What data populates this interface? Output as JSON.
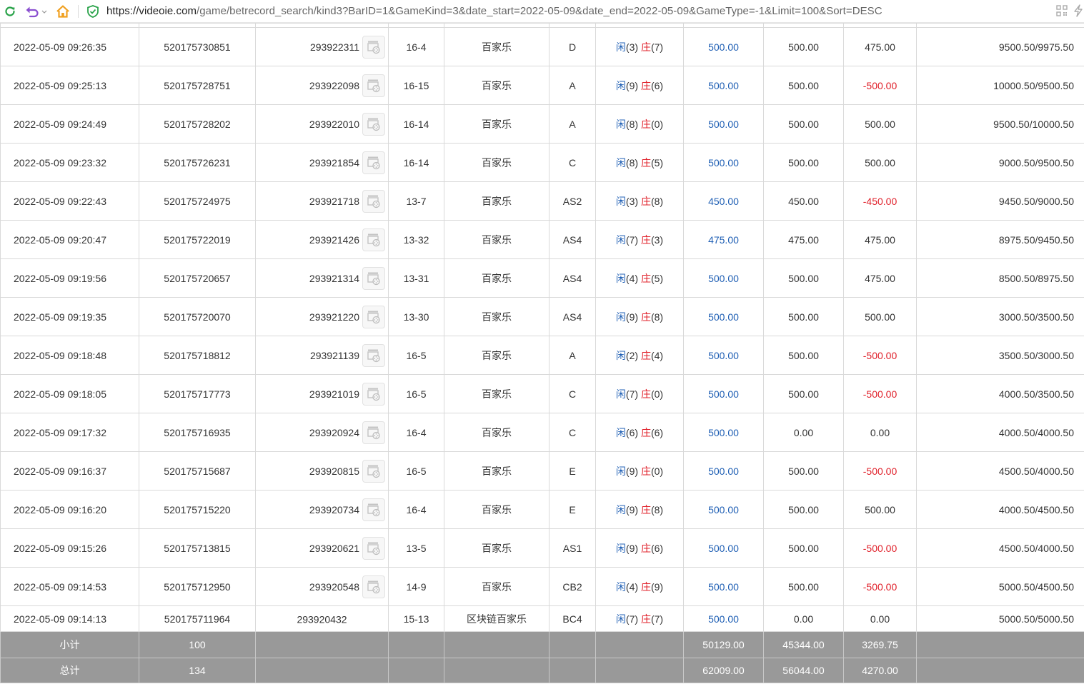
{
  "browser": {
    "url_host": "https://videoie.com",
    "url_path": "/game/betrecord_search/kind3?BarID=1&GameKind=3&date_start=2022-05-09&date_end=2022-05-09&GameType=-1&Limit=100&Sort=DESC"
  },
  "colors": {
    "positive": "#1f5fb4",
    "negative": "#e0202a",
    "summary_bg": "#999999"
  },
  "rows": [
    {
      "time": "2022-05-09 09:26:35",
      "bet_id": "520175730851",
      "game_no": "293922311",
      "shoe": "16-4",
      "game": "百家乐",
      "table": "D",
      "player_label": "闲",
      "player_pts": "(3)",
      "banker_label": "庄",
      "banker_pts": "(7)",
      "bet": "500.00",
      "valid": "500.00",
      "result": "475.00",
      "result_sign": "pos",
      "balance": "9500.50/9975.50",
      "video_icon": "video-replay-icon"
    },
    {
      "time": "2022-05-09 09:25:13",
      "bet_id": "520175728751",
      "game_no": "293922098",
      "shoe": "16-15",
      "game": "百家乐",
      "table": "A",
      "player_label": "闲",
      "player_pts": "(9)",
      "banker_label": "庄",
      "banker_pts": "(6)",
      "bet": "500.00",
      "valid": "500.00",
      "result": "-500.00",
      "result_sign": "neg",
      "balance": "10000.50/9500.50",
      "video_icon": "video-replay-icon"
    },
    {
      "time": "2022-05-09 09:24:49",
      "bet_id": "520175728202",
      "game_no": "293922010",
      "shoe": "16-14",
      "game": "百家乐",
      "table": "A",
      "player_label": "闲",
      "player_pts": "(8)",
      "banker_label": "庄",
      "banker_pts": "(0)",
      "bet": "500.00",
      "valid": "500.00",
      "result": "500.00",
      "result_sign": "pos",
      "balance": "9500.50/10000.50",
      "video_icon": "video-replay-icon"
    },
    {
      "time": "2022-05-09 09:23:32",
      "bet_id": "520175726231",
      "game_no": "293921854",
      "shoe": "16-14",
      "game": "百家乐",
      "table": "C",
      "player_label": "闲",
      "player_pts": "(8)",
      "banker_label": "庄",
      "banker_pts": "(5)",
      "bet": "500.00",
      "valid": "500.00",
      "result": "500.00",
      "result_sign": "pos",
      "balance": "9000.50/9500.50",
      "video_icon": "video-replay-icon"
    },
    {
      "time": "2022-05-09 09:22:43",
      "bet_id": "520175724975",
      "game_no": "293921718",
      "shoe": "13-7",
      "game": "百家乐",
      "table": "AS2",
      "player_label": "闲",
      "player_pts": "(3)",
      "banker_label": "庄",
      "banker_pts": "(8)",
      "bet": "450.00",
      "valid": "450.00",
      "result": "-450.00",
      "result_sign": "neg",
      "balance": "9450.50/9000.50",
      "video_icon": "video-replay-icon"
    },
    {
      "time": "2022-05-09 09:20:47",
      "bet_id": "520175722019",
      "game_no": "293921426",
      "shoe": "13-32",
      "game": "百家乐",
      "table": "AS4",
      "player_label": "闲",
      "player_pts": "(7)",
      "banker_label": "庄",
      "banker_pts": "(3)",
      "bet": "475.00",
      "valid": "475.00",
      "result": "475.00",
      "result_sign": "pos",
      "balance": "8975.50/9450.50",
      "video_icon": "video-replay-icon"
    },
    {
      "time": "2022-05-09 09:19:56",
      "bet_id": "520175720657",
      "game_no": "293921314",
      "shoe": "13-31",
      "game": "百家乐",
      "table": "AS4",
      "player_label": "闲",
      "player_pts": "(4)",
      "banker_label": "庄",
      "banker_pts": "(5)",
      "bet": "500.00",
      "valid": "500.00",
      "result": "475.00",
      "result_sign": "pos",
      "balance": "8500.50/8975.50",
      "video_icon": "video-replay-icon"
    },
    {
      "time": "2022-05-09 09:19:35",
      "bet_id": "520175720070",
      "game_no": "293921220",
      "shoe": "13-30",
      "game": "百家乐",
      "table": "AS4",
      "player_label": "闲",
      "player_pts": "(9)",
      "banker_label": "庄",
      "banker_pts": "(8)",
      "bet": "500.00",
      "valid": "500.00",
      "result": "500.00",
      "result_sign": "pos",
      "balance": "3000.50/3500.50",
      "video_icon": "video-replay-icon"
    },
    {
      "time": "2022-05-09 09:18:48",
      "bet_id": "520175718812",
      "game_no": "293921139",
      "shoe": "16-5",
      "game": "百家乐",
      "table": "A",
      "player_label": "闲",
      "player_pts": "(2)",
      "banker_label": "庄",
      "banker_pts": "(4)",
      "bet": "500.00",
      "valid": "500.00",
      "result": "-500.00",
      "result_sign": "neg",
      "balance": "3500.50/3000.50",
      "video_icon": "video-replay-icon"
    },
    {
      "time": "2022-05-09 09:18:05",
      "bet_id": "520175717773",
      "game_no": "293921019",
      "shoe": "16-5",
      "game": "百家乐",
      "table": "C",
      "player_label": "闲",
      "player_pts": "(7)",
      "banker_label": "庄",
      "banker_pts": "(0)",
      "bet": "500.00",
      "valid": "500.00",
      "result": "-500.00",
      "result_sign": "neg",
      "balance": "4000.50/3500.50",
      "video_icon": "video-replay-icon"
    },
    {
      "time": "2022-05-09 09:17:32",
      "bet_id": "520175716935",
      "game_no": "293920924",
      "shoe": "16-4",
      "game": "百家乐",
      "table": "C",
      "player_label": "闲",
      "player_pts": "(6)",
      "banker_label": "庄",
      "banker_pts": "(6)",
      "bet": "500.00",
      "valid": "0.00",
      "result": "0.00",
      "result_sign": "zero",
      "balance": "4000.50/4000.50",
      "video_icon": "video-replay-icon"
    },
    {
      "time": "2022-05-09 09:16:37",
      "bet_id": "520175715687",
      "game_no": "293920815",
      "shoe": "16-5",
      "game": "百家乐",
      "table": "E",
      "player_label": "闲",
      "player_pts": "(9)",
      "banker_label": "庄",
      "banker_pts": "(0)",
      "bet": "500.00",
      "valid": "500.00",
      "result": "-500.00",
      "result_sign": "neg",
      "balance": "4500.50/4000.50",
      "video_icon": "video-replay-icon"
    },
    {
      "time": "2022-05-09 09:16:20",
      "bet_id": "520175715220",
      "game_no": "293920734",
      "shoe": "16-4",
      "game": "百家乐",
      "table": "E",
      "player_label": "闲",
      "player_pts": "(9)",
      "banker_label": "庄",
      "banker_pts": "(8)",
      "bet": "500.00",
      "valid": "500.00",
      "result": "500.00",
      "result_sign": "pos",
      "balance": "4000.50/4500.50",
      "video_icon": "video-replay-icon"
    },
    {
      "time": "2022-05-09 09:15:26",
      "bet_id": "520175713815",
      "game_no": "293920621",
      "shoe": "13-5",
      "game": "百家乐",
      "table": "AS1",
      "player_label": "闲",
      "player_pts": "(9)",
      "banker_label": "庄",
      "banker_pts": "(6)",
      "bet": "500.00",
      "valid": "500.00",
      "result": "-500.00",
      "result_sign": "neg",
      "balance": "4500.50/4000.50",
      "video_icon": "video-replay-icon"
    },
    {
      "time": "2022-05-09 09:14:53",
      "bet_id": "520175712950",
      "game_no": "293920548",
      "shoe": "14-9",
      "game": "百家乐",
      "table": "CB2",
      "player_label": "闲",
      "player_pts": "(4)",
      "banker_label": "庄",
      "banker_pts": "(9)",
      "bet": "500.00",
      "valid": "500.00",
      "result": "-500.00",
      "result_sign": "neg",
      "balance": "5000.50/4500.50",
      "video_icon": "video-replay-icon"
    },
    {
      "time": "2022-05-09 09:14:13",
      "bet_id": "520175711964",
      "game_no": "293920432",
      "shoe": "15-13",
      "game": "区块链百家乐",
      "table": "BC4",
      "player_label": "闲",
      "player_pts": "(7)",
      "banker_label": "庄",
      "banker_pts": "(7)",
      "bet": "500.00",
      "valid": "0.00",
      "result": "0.00",
      "result_sign": "zero",
      "balance": "5000.50/5000.50",
      "video_icon": ""
    }
  ],
  "subtotal": {
    "label": "小计",
    "count": "100",
    "bet": "50129.00",
    "valid": "45344.00",
    "result": "3269.75"
  },
  "total": {
    "label": "总计",
    "count": "134",
    "bet": "62009.00",
    "valid": "56044.00",
    "result": "4270.00"
  }
}
